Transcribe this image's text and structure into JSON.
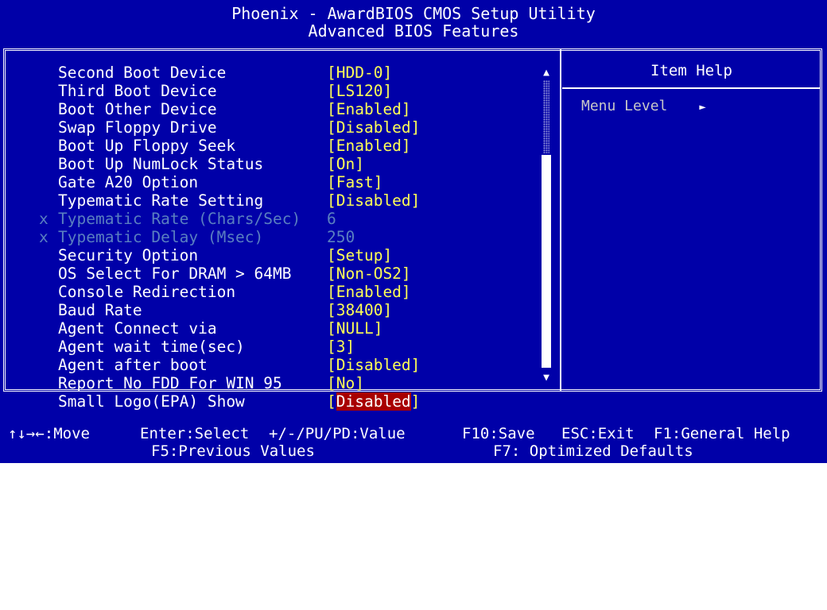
{
  "header": {
    "title": "Phoenix - AwardBIOS CMOS Setup Utility",
    "subtitle": "Advanced BIOS Features"
  },
  "settings": [
    {
      "label": "Second Boot Device",
      "value": "[HDD-0]"
    },
    {
      "label": "Third Boot Device",
      "value": "[LS120]"
    },
    {
      "label": "Boot Other Device",
      "value": "[Enabled]"
    },
    {
      "label": "Swap Floppy Drive",
      "value": "[Disabled]"
    },
    {
      "label": "Boot Up Floppy Seek",
      "value": "[Enabled]"
    },
    {
      "label": "Boot Up NumLock Status",
      "value": "[On]"
    },
    {
      "label": "Gate A20 Option",
      "value": "[Fast]"
    },
    {
      "label": "Typematic Rate Setting",
      "value": "[Disabled]"
    },
    {
      "mark": "x",
      "label": "Typematic Rate (Chars/Sec)",
      "value": "6"
    },
    {
      "mark": "x",
      "label": "Typematic Delay (Msec)",
      "value": "250"
    },
    {
      "label": "Security Option",
      "value": "[Setup]"
    },
    {
      "label": "OS Select For DRAM > 64MB",
      "value": "[Non-OS2]"
    },
    {
      "label": "Console Redirection",
      "value": "[Enabled]"
    },
    {
      "label": "Baud Rate",
      "value": "[38400]"
    },
    {
      "label": "Agent Connect via",
      "value": "[NULL]"
    },
    {
      "label": "Agent wait time(sec)",
      "value": "[3]"
    },
    {
      "label": "Agent after boot",
      "value": "[Disabled]"
    },
    {
      "label": "Report No FDD For WIN 95",
      "value": "[No]"
    },
    {
      "label": "Small Logo(EPA) Show",
      "value_open": "[",
      "value": "Disabled",
      "value_close": "]"
    }
  ],
  "scrollbar": {
    "up_glyph": "▲",
    "down_glyph": "▼"
  },
  "help": {
    "title": "Item Help",
    "menu_level_label": "Menu Level",
    "menu_level_arrow": "►"
  },
  "footer": {
    "move": "↑↓→←:Move",
    "select": "Enter:Select",
    "value": "+/-/PU/PD:Value",
    "save": "F10:Save",
    "exit": "ESC:Exit",
    "help": "F1:General Help",
    "previous": "F5:Previous Values",
    "defaults": "F7: Optimized Defaults"
  },
  "colors": {
    "background": "#0000a8",
    "text": "#ffffff",
    "value": "#ffff55",
    "disabled": "#5a7fc0",
    "selection": "#a80000"
  }
}
